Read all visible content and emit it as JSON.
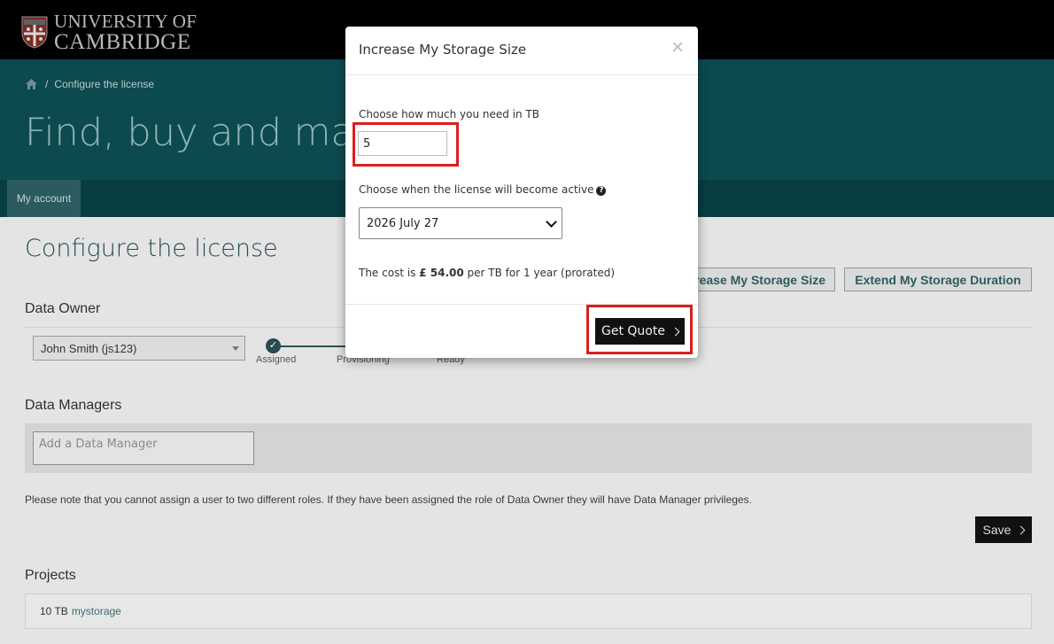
{
  "header": {
    "university_line1": "UNIVERSITY OF",
    "university_line2": "CAMBRIDGE",
    "crest_icon": "cambridge-crest-icon"
  },
  "breadcrumb": {
    "home_icon": "home-icon",
    "separator": "/",
    "current": "Configure the license"
  },
  "hero": {
    "title": "Find, buy and manag"
  },
  "tabs": [
    {
      "label": "My account",
      "active": true
    }
  ],
  "main": {
    "title": "Configure the license",
    "actions": {
      "increase_label": "rease My Storage Size",
      "extend_label": "Extend My Storage Duration"
    },
    "data_owner": {
      "heading": "Data Owner",
      "selected": "John Smith (js123)",
      "steps": [
        "Assigned",
        "Provisioning",
        "Ready"
      ]
    },
    "data_managers": {
      "heading": "Data Managers",
      "placeholder": "Add a Data Manager"
    },
    "note": "Please note that you cannot assign a user to two different roles. If they have been assigned the role of Data Owner they will have Data Manager privileges.",
    "save_label": "Save",
    "projects": {
      "heading": "Projects",
      "size": "10 TB",
      "link": "mystorage"
    }
  },
  "modal": {
    "title": "Increase My Storage Size",
    "close": "×",
    "amount_label": "Choose how much you need in TB",
    "amount_value": "5",
    "date_label": "Choose when the license will become active",
    "date_value": "2026 July 27",
    "cost_prefix": "The cost is ",
    "cost_amount": "£ 54.00",
    "cost_suffix": " per TB for 1 year (prorated)",
    "quote_label": "Get Quote"
  },
  "colors": {
    "highlight": "#dd1d1d",
    "hero_bg": "#0c4a4f",
    "topbar_bg": "#000000"
  }
}
